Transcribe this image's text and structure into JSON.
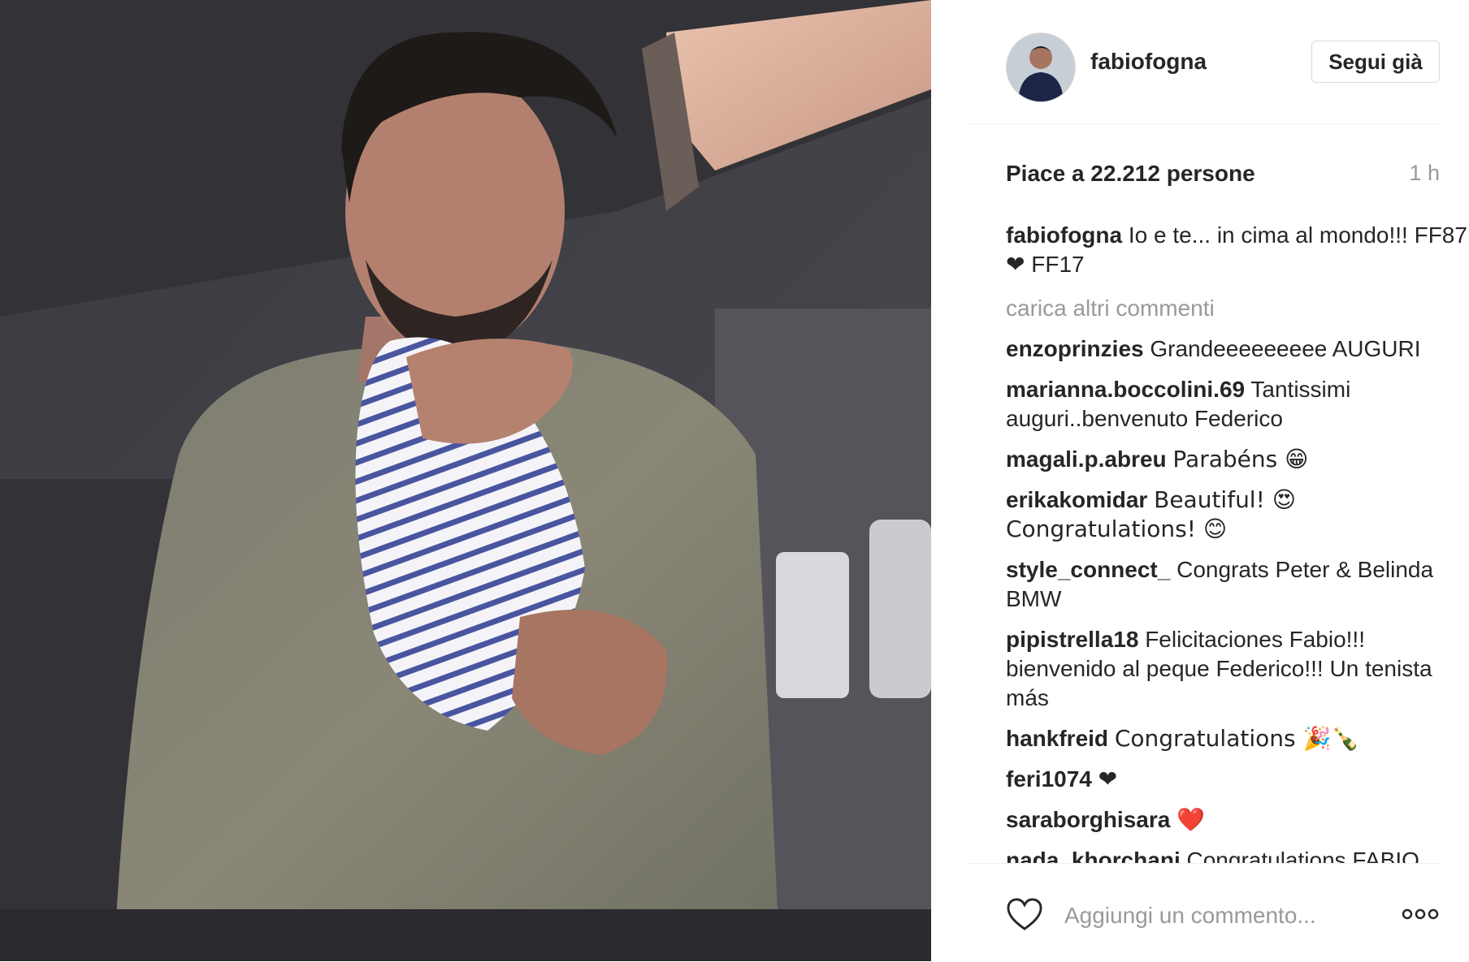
{
  "post": {
    "username": "fabiofogna",
    "follow_label": "Segui già",
    "likes": "Piace a 22.212 persone",
    "time": "1 h",
    "caption_user": "fabiofogna",
    "caption_text": "Io e te... in cima al mondo!!! FF87 ❤ FF17",
    "load_more": "carica altri commenti",
    "add_comment_placeholder": "Aggiungi un commento..."
  },
  "comments": [
    {
      "user": "enzoprinzies",
      "text": "Grandeeeeeeeee AUGURI"
    },
    {
      "user": "marianna.boccolini.69",
      "text": "Tantissimi auguri..benvenuto Federico"
    },
    {
      "user": "magali.p.abreu",
      "text": "Parabéns 😁"
    },
    {
      "user": "erikakomidar",
      "text": "Beautiful! 😍 Congratulations! 😊"
    },
    {
      "user": "style_connect_",
      "text": "Congrats Peter & Belinda BMW"
    },
    {
      "user": "pipistrella18",
      "text": "Felicitaciones Fabio!!! bienvenido al peque Federico!!! Un tenista más"
    },
    {
      "user": "hankfreid",
      "text": "Congratulations 🎉🍾"
    },
    {
      "user": "feri1074",
      "text": "❤"
    },
    {
      "user": "saraborghisara",
      "text": "❤️"
    },
    {
      "user": "nada_khorchani",
      "text": "Congratulations FABIO"
    }
  ],
  "icons": {
    "like": "heart-outline-icon",
    "options": "more-options-icon"
  },
  "colors": {
    "text": "#262626",
    "muted": "#999999",
    "border": "#dbdbdb"
  }
}
